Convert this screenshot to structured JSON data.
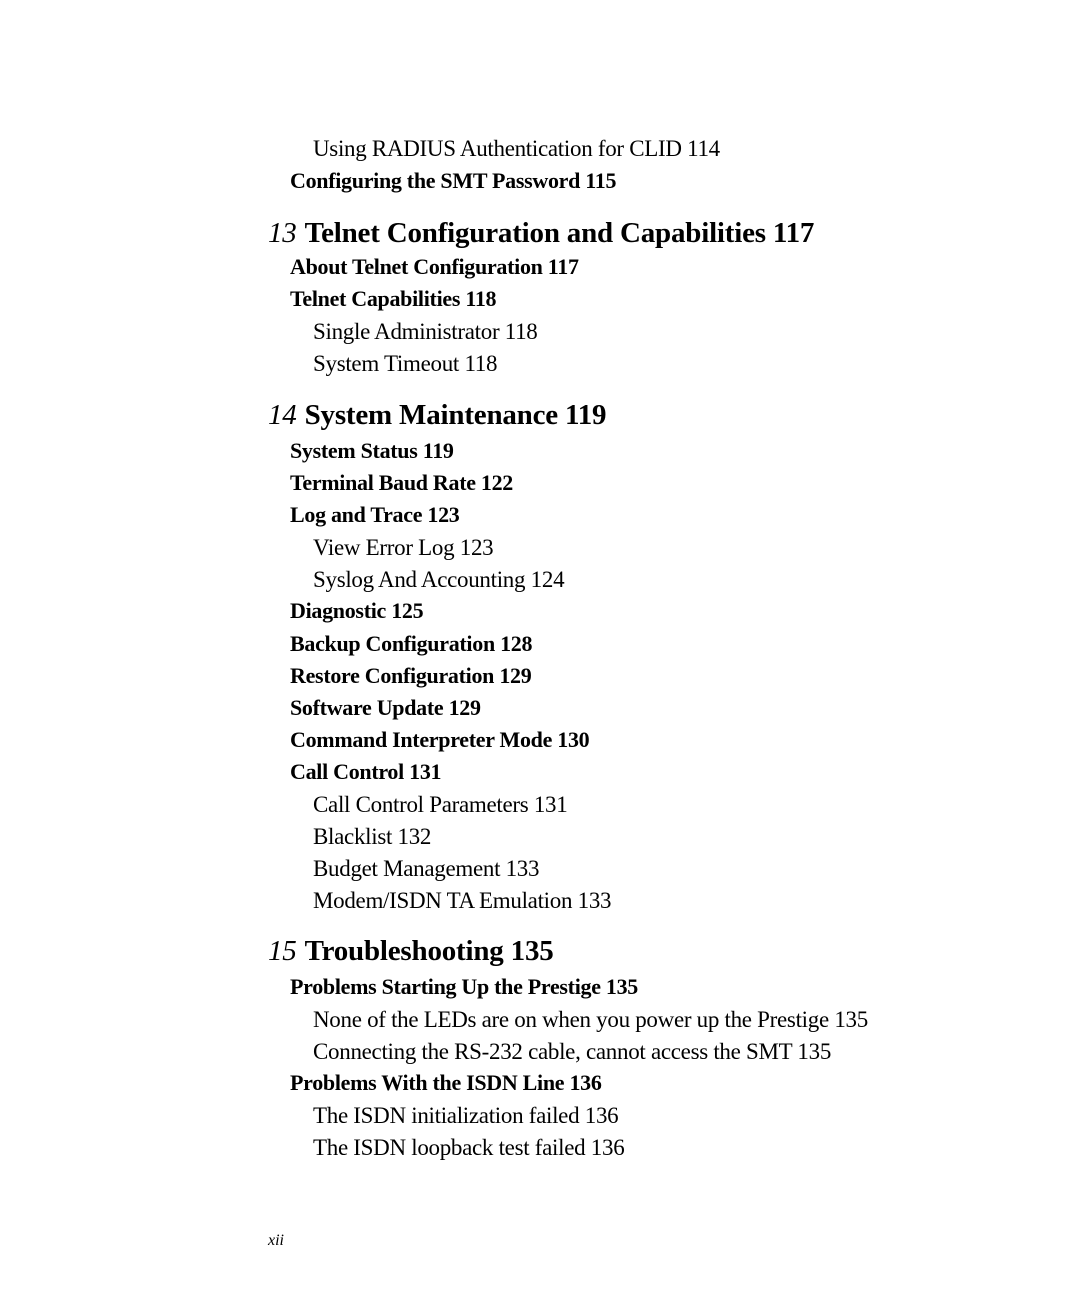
{
  "toc": {
    "entries": [
      {
        "level": 3,
        "title": "Using RADIUS Authentication for CLID",
        "page": "114"
      },
      {
        "level": 2,
        "title": "Configuring the SMT Password",
        "page": "115"
      },
      {
        "level": 1,
        "chapter": "13",
        "title": "Telnet Configuration and Capabilities",
        "page": "117"
      },
      {
        "level": 2,
        "title": "About Telnet Configuration",
        "page": "117"
      },
      {
        "level": 2,
        "title": "Telnet Capabilities",
        "page": "118"
      },
      {
        "level": 3,
        "title": "Single Administrator",
        "page": "118"
      },
      {
        "level": 3,
        "title": "System Timeout",
        "page": "118"
      },
      {
        "level": 1,
        "chapter": "14",
        "title": "System Maintenance",
        "page": "119"
      },
      {
        "level": 2,
        "title": "System Status",
        "page": "119"
      },
      {
        "level": 2,
        "title": "Terminal Baud Rate",
        "page": "122"
      },
      {
        "level": 2,
        "title": "Log and Trace",
        "page": "123"
      },
      {
        "level": 3,
        "title": "View Error Log",
        "page": "123"
      },
      {
        "level": 3,
        "title": "Syslog And Accounting",
        "page": "124"
      },
      {
        "level": 2,
        "title": "Diagnostic",
        "page": "125"
      },
      {
        "level": 2,
        "title": "Backup Configuration",
        "page": "128"
      },
      {
        "level": 2,
        "title": "Restore Configuration",
        "page": "129"
      },
      {
        "level": 2,
        "title": "Software Update",
        "page": "129"
      },
      {
        "level": 2,
        "title": "Command Interpreter Mode",
        "page": "130"
      },
      {
        "level": 2,
        "title": "Call Control",
        "page": "131"
      },
      {
        "level": 3,
        "title": "Call Control Parameters",
        "page": "131"
      },
      {
        "level": 3,
        "title": "Blacklist",
        "page": "132"
      },
      {
        "level": 3,
        "title": "Budget Management",
        "page": "133"
      },
      {
        "level": 3,
        "title": "Modem/ISDN TA Emulation",
        "page": "133"
      },
      {
        "level": 1,
        "chapter": "15",
        "title": "Troubleshooting",
        "page": "135"
      },
      {
        "level": 2,
        "title": "Problems Starting Up the Prestige",
        "page": "135"
      },
      {
        "level": 3,
        "title": "None of the LEDs are on when you power up the Prestige",
        "page": "135"
      },
      {
        "level": 3,
        "title": "Connecting the RS-232 cable, cannot access the SMT",
        "page": "135"
      },
      {
        "level": 2,
        "title": "Problems With the ISDN Line",
        "page": "136"
      },
      {
        "level": 3,
        "title": "The ISDN initialization failed",
        "page": "136"
      },
      {
        "level": 3,
        "title": "The ISDN loopback test failed",
        "page": "136"
      }
    ]
  },
  "footer": {
    "page_number": "xii"
  }
}
